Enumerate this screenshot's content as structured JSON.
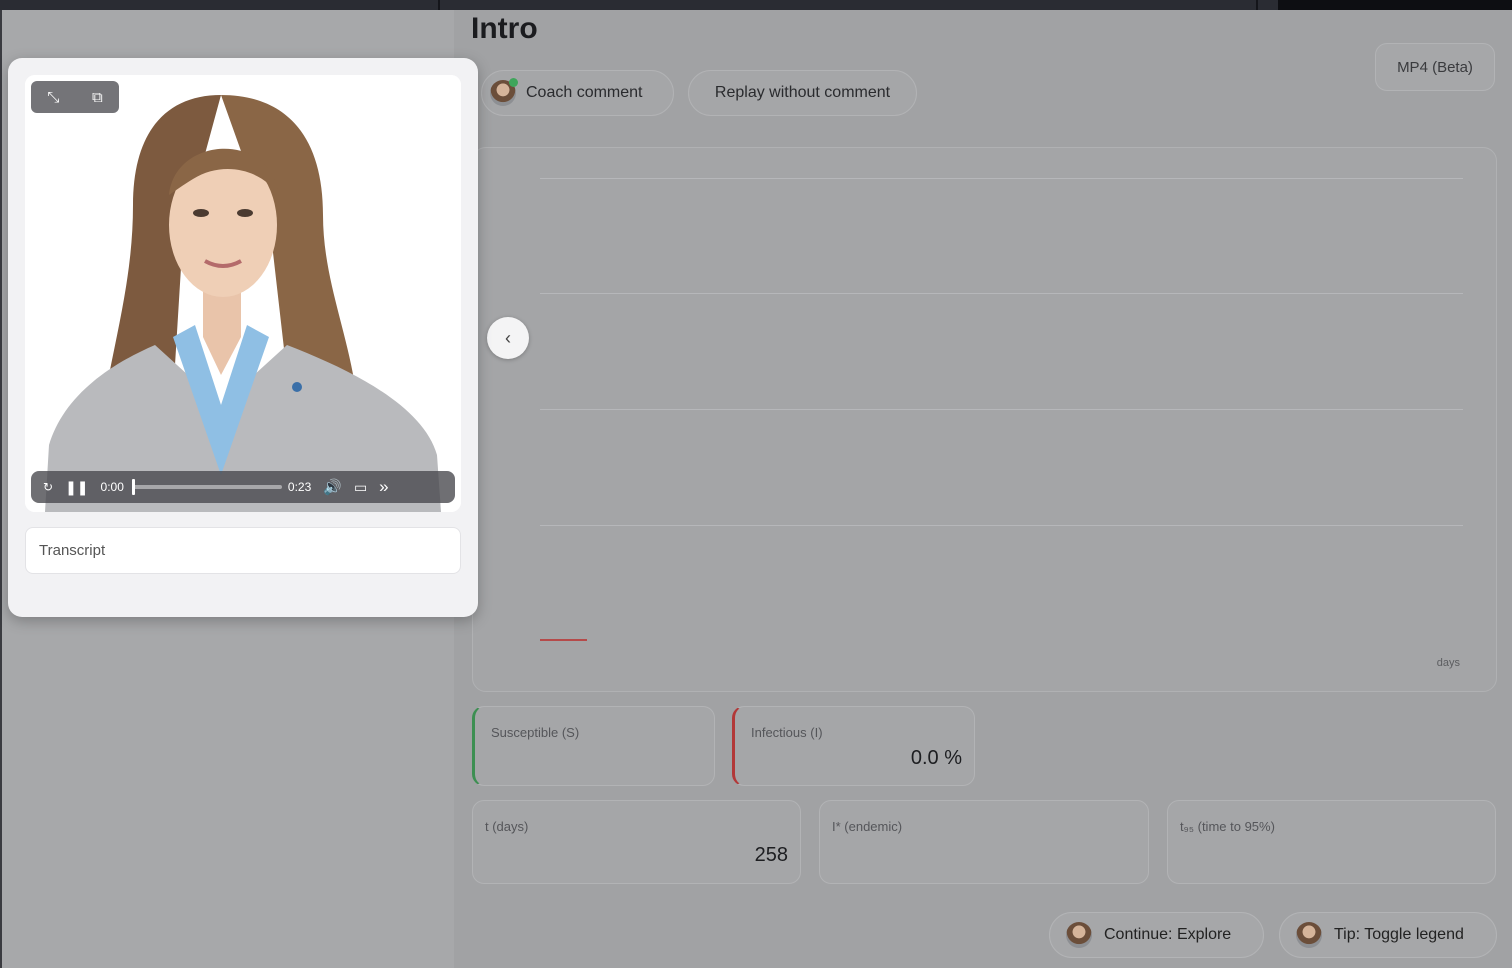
{
  "page": {
    "title": "Intro"
  },
  "toolbar": {
    "coach_comment_label": "Coach comment",
    "replay_label": "Replay without comment",
    "export_label": "MP4 (Beta)"
  },
  "chart": {
    "x_unit_label": "days"
  },
  "stats": {
    "susceptible": {
      "label": "Susceptible (S)",
      "value": ""
    },
    "infectious": {
      "label": "Infectious (I)",
      "value": "0.0 %"
    },
    "t_days": {
      "label": "t (days)",
      "value": "258"
    },
    "i_endemic": {
      "label": "I* (endemic)",
      "value": ""
    },
    "t95": {
      "label": "t₉₅ (time to 95%)",
      "value": ""
    }
  },
  "video": {
    "current_time": "0:00",
    "duration": "0:23",
    "progress": 0.0
  },
  "transcript": {
    "label": "Transcript"
  },
  "actions": {
    "continue_label": "Continue: Explore",
    "tip_label": "Tip: Toggle legend"
  },
  "icons": {
    "expand": "expand-icon",
    "pip": "picture-in-picture-icon",
    "replay": "replay-icon",
    "pause": "pause-icon",
    "volume": "volume-icon",
    "airplay": "airplay-icon",
    "skip": "skip-forward-icon",
    "collapse": "chevron-left-icon"
  },
  "colors": {
    "susceptible_accent": "#3d8f52",
    "infectious_accent": "#b23838"
  }
}
